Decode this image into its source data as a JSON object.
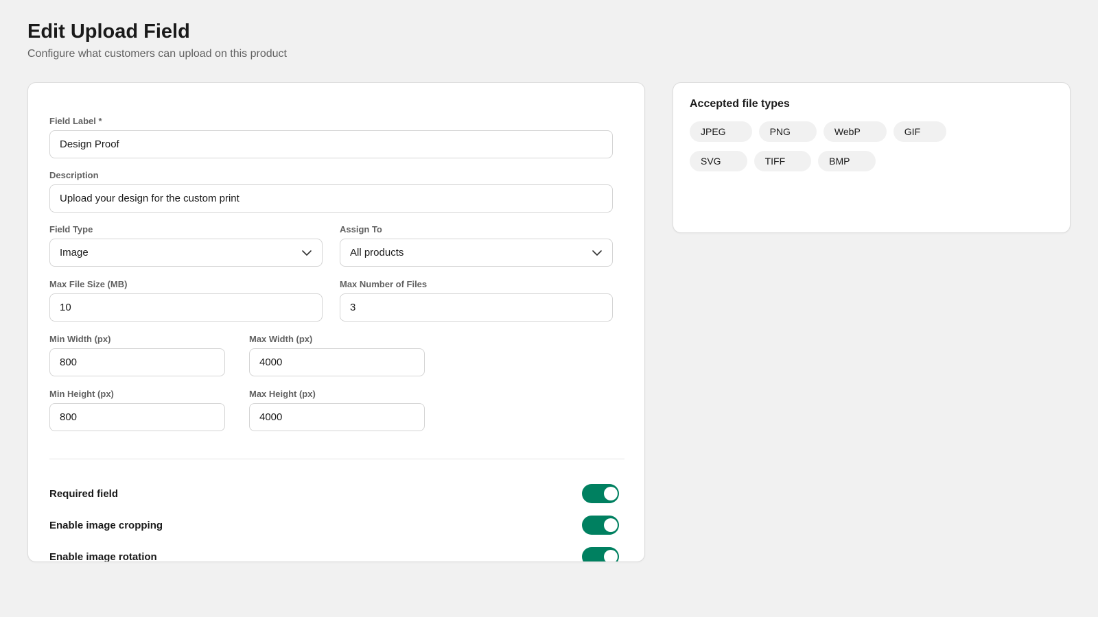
{
  "header": {
    "title": "Edit Upload Field",
    "subtitle": "Configure what customers can upload on this product"
  },
  "form": {
    "field_label": {
      "label": "Field Label *",
      "value": "Design Proof"
    },
    "description": {
      "label": "Description",
      "value": "Upload your design for the custom print"
    },
    "field_type": {
      "label": "Field Type",
      "value": "Image"
    },
    "assign_to": {
      "label": "Assign To",
      "value": "All products"
    },
    "max_file_size": {
      "label": "Max File Size (MB)",
      "value": "10"
    },
    "max_files": {
      "label": "Max Number of Files",
      "value": "3"
    },
    "min_width": {
      "label": "Min Width (px)",
      "value": "800"
    },
    "max_width": {
      "label": "Max Width (px)",
      "value": "4000"
    },
    "min_height": {
      "label": "Min Height (px)",
      "value": "800"
    },
    "max_height": {
      "label": "Max Height (px)",
      "value": "4000"
    }
  },
  "toggles": [
    {
      "label": "Required field",
      "on": true
    },
    {
      "label": "Enable image cropping",
      "on": true
    },
    {
      "label": "Enable image rotation",
      "on": true
    }
  ],
  "accepted_types": {
    "title": "Accepted file types",
    "chips": [
      "JPEG",
      "PNG",
      "WebP",
      "GIF",
      "SVG",
      "TIFF",
      "BMP"
    ]
  },
  "colors": {
    "accent": "#008060",
    "background": "#f1f1f1",
    "card": "#ffffff"
  },
  "icons": {
    "select_arrow": "chevron-down-icon"
  }
}
